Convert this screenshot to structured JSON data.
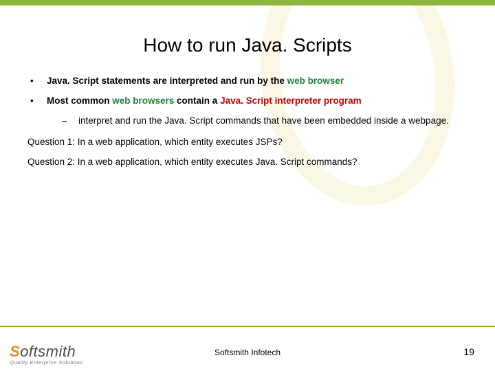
{
  "title": "How to run Java. Scripts",
  "bullets": [
    {
      "pre": "Java. Script statements are interpreted and run by the ",
      "green": "web browser",
      "post": ""
    },
    {
      "pre": "Most common ",
      "green": "web browsers",
      "mid": " contain a ",
      "red": "Java. Script interpreter program",
      "post": ""
    }
  ],
  "sub_bullet": "interpret and run the Java. Script commands that have been embedded inside a webpage.",
  "questions": [
    "Question 1: In a web application, which entity executes JSPs?",
    "Question 2: In a web application, which entity executes Java. Script commands?"
  ],
  "logo": {
    "initial": "S",
    "rest": "oftsmith",
    "tagline": "Quality Enterprise Solutions"
  },
  "footer_center": "Softsmith Infotech",
  "page_number": "19"
}
